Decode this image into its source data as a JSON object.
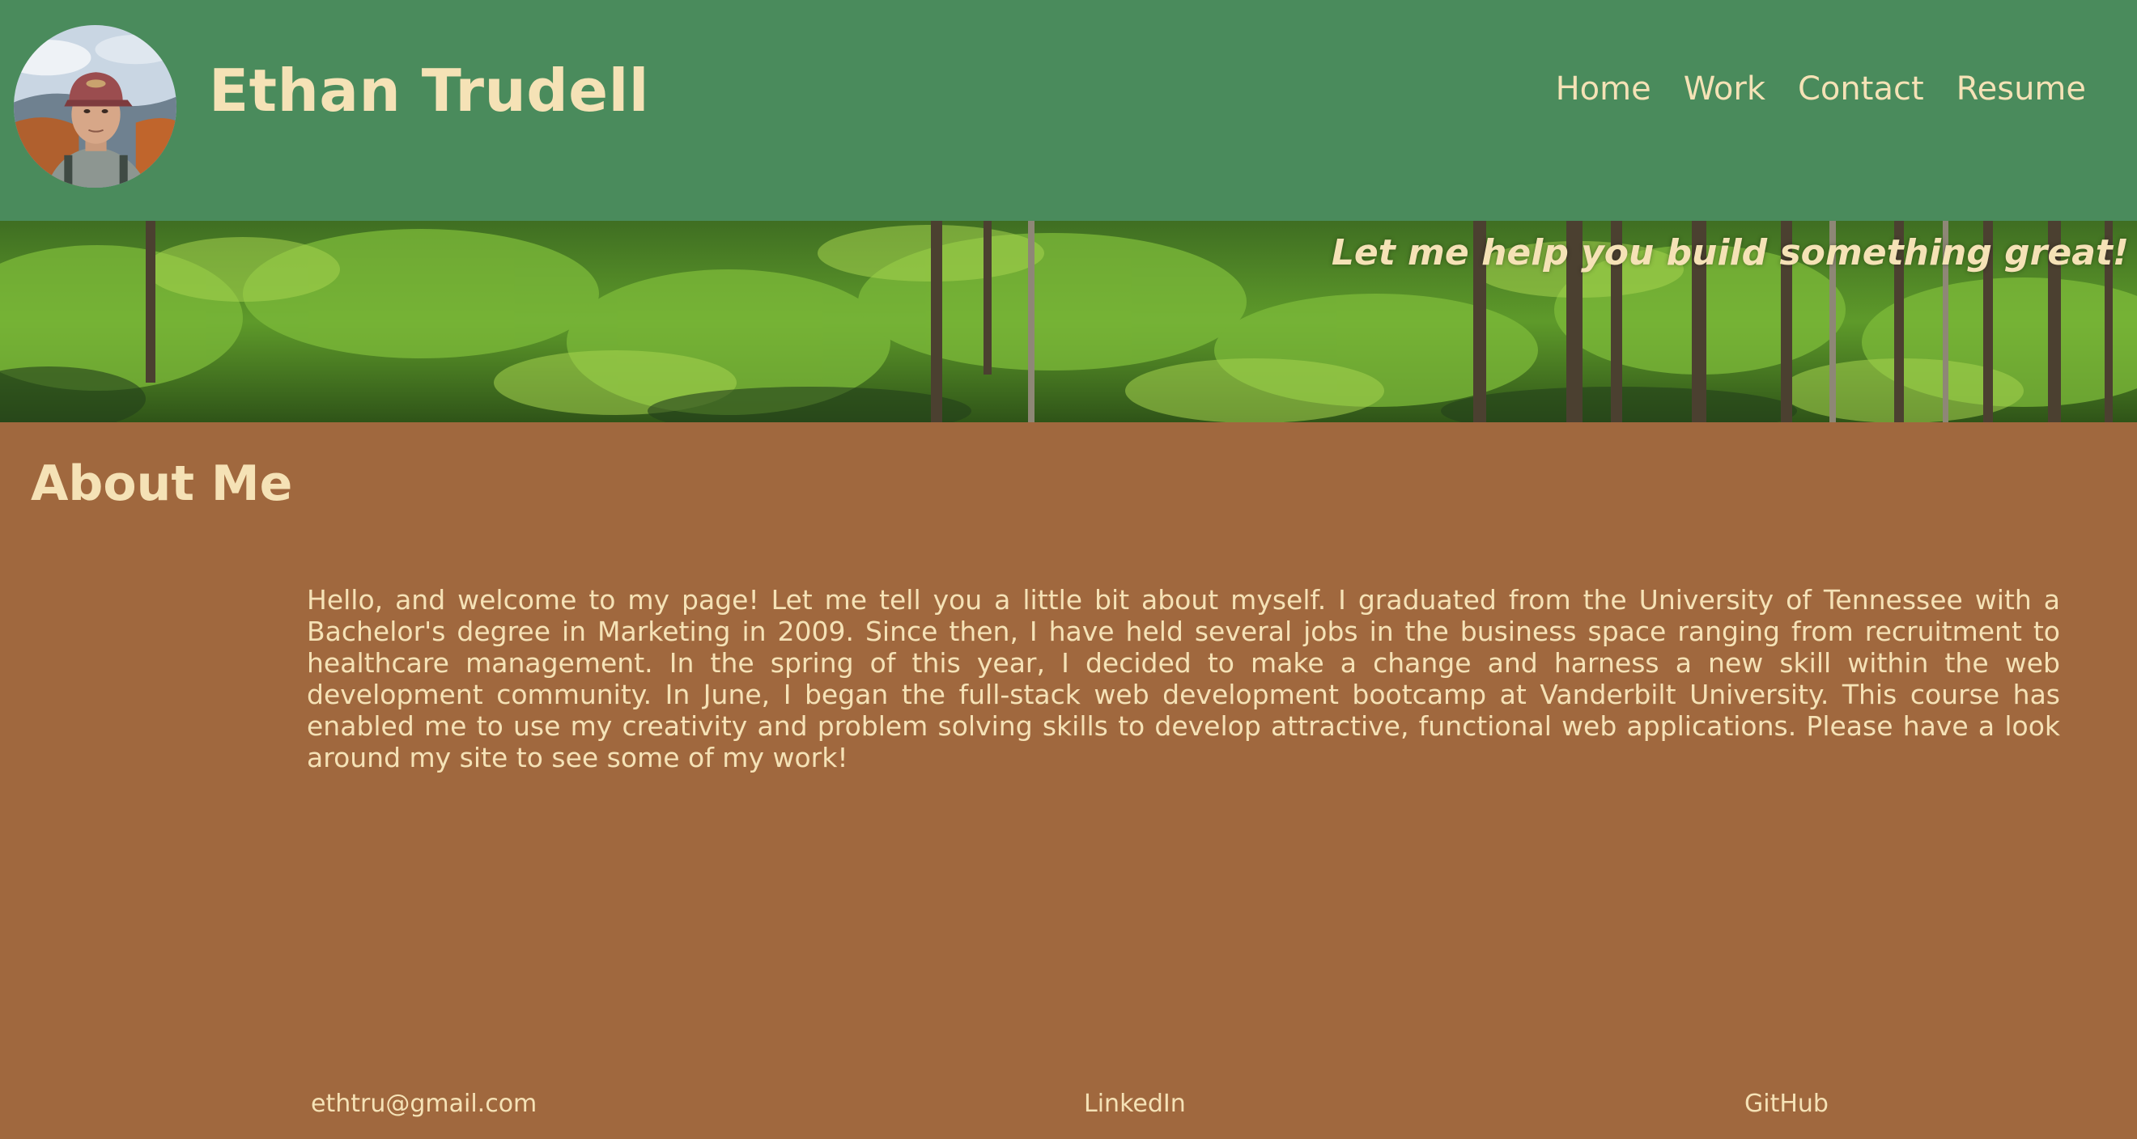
{
  "header": {
    "site_name": "Ethan Trudell",
    "avatar_icon": "profile-photo",
    "nav": [
      {
        "label": "Home"
      },
      {
        "label": "Work"
      },
      {
        "label": "Contact"
      },
      {
        "label": "Resume"
      }
    ]
  },
  "hero": {
    "tagline": "Let me help you build something great!"
  },
  "about": {
    "title": "About Me",
    "text": "Hello, and welcome to my page! Let me tell you a little bit about myself. I graduated from the University of Tennessee with a Bachelor's degree in Marketing in 2009. Since then, I have held several jobs in the business space ranging from recruitment to healthcare management. In the spring of this year, I decided to make a change and harness a new skill within the web development community. In June, I began the full-stack web development bootcamp at Vanderbilt University. This course has enabled me to use my creativity and problem solving skills to develop attractive, functional web applications. Please have a look around my site to see some of my work!"
  },
  "footer": {
    "email": "ethtru@gmail.com",
    "linkedin": "LinkedIn",
    "github": "GitHub"
  },
  "colors": {
    "header_bg": "#4a8b5c",
    "body_bg": "#a0683e",
    "text_cream": "#f5e2b6"
  }
}
